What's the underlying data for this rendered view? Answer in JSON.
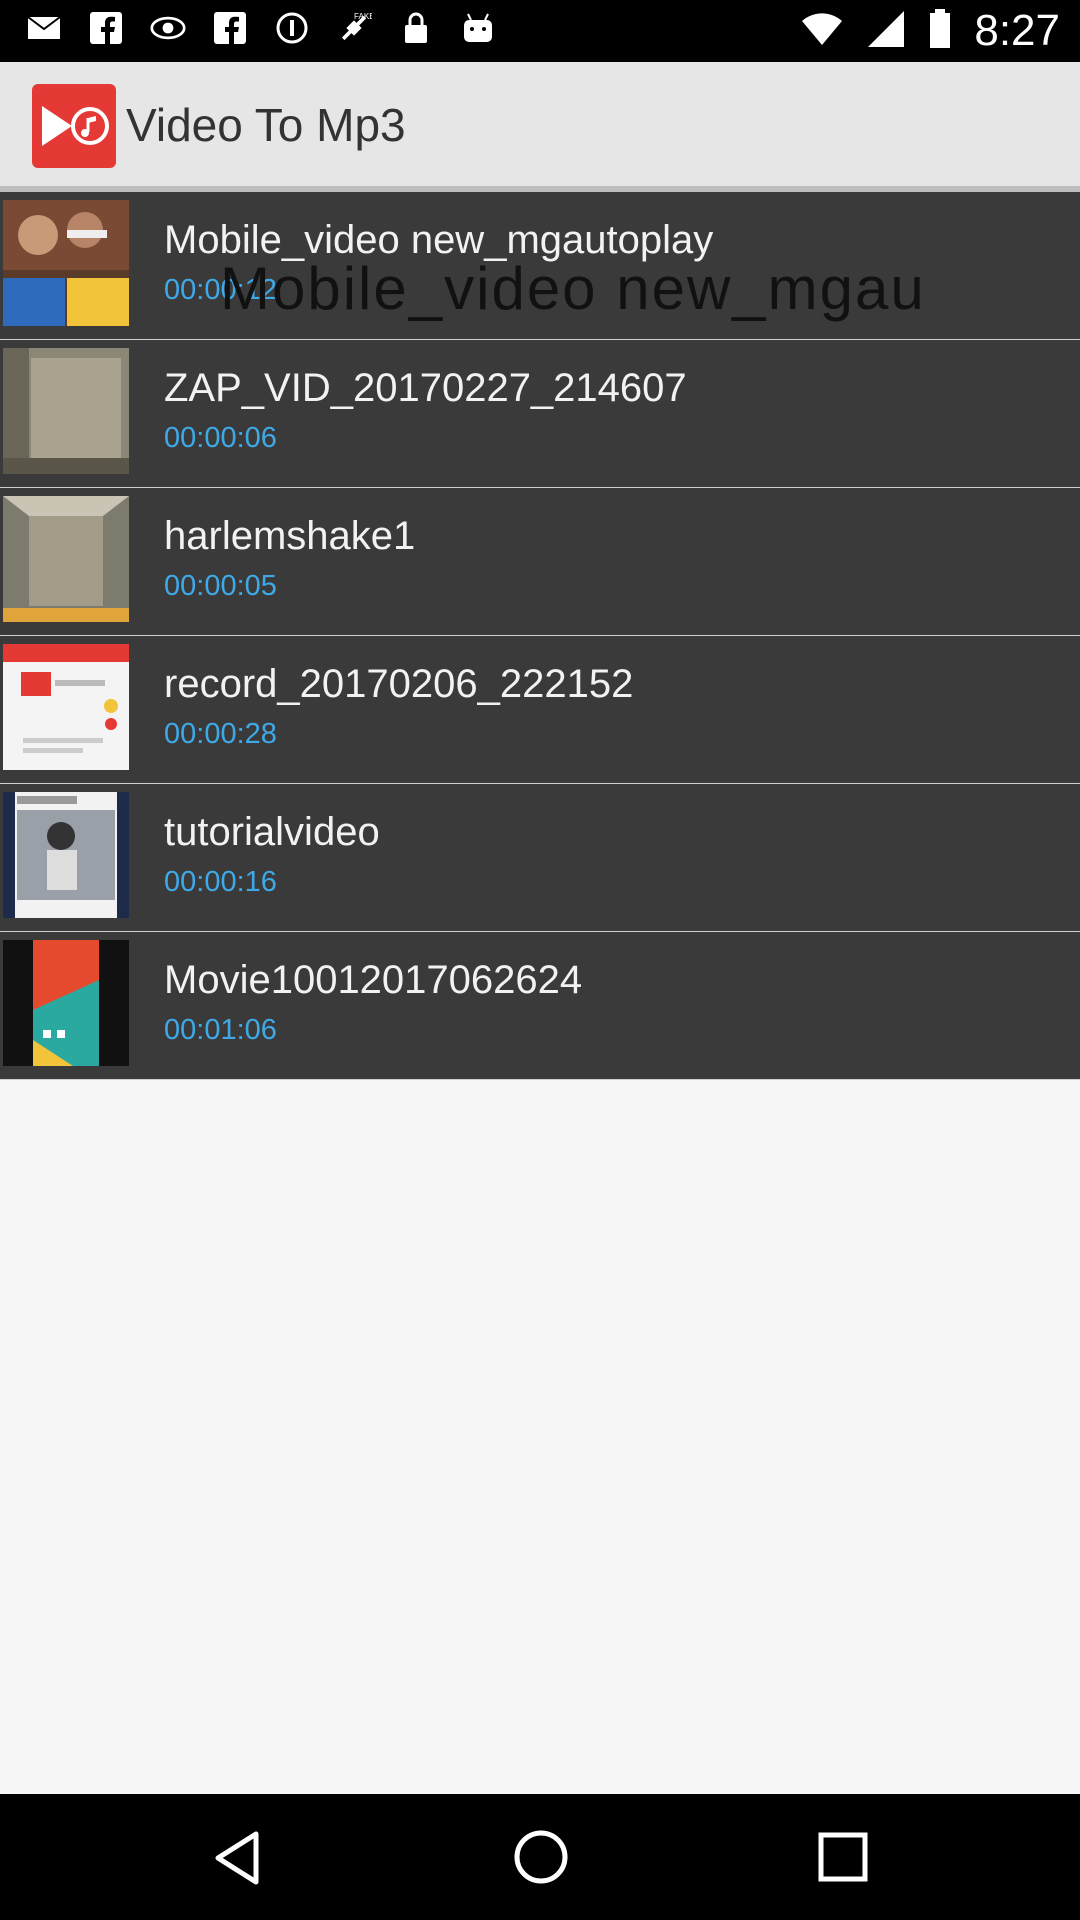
{
  "status_bar": {
    "time": "8:27",
    "left_icons": [
      "mail-icon",
      "facebook-icon",
      "eye-icon",
      "facebook-icon",
      "info-icon",
      "fake-gps-icon",
      "lock-icon",
      "android-icon"
    ]
  },
  "app_bar": {
    "title": "Video To Mp3",
    "logo_color": "#e53935"
  },
  "videos": [
    {
      "title": "Mobile_video new_mgautoplay",
      "duration": "00:00:12"
    },
    {
      "title": "ZAP_VID_20170227_214607",
      "duration": "00:00:06"
    },
    {
      "title": "harlemshake1",
      "duration": "00:00:05"
    },
    {
      "title": "record_20170206_222152",
      "duration": "00:00:28"
    },
    {
      "title": "tutorialvideo",
      "duration": "00:00:16"
    },
    {
      "title": "Movie10012017062624",
      "duration": "00:01:06"
    }
  ],
  "overlay": {
    "text": "Mobile_video new_mgau"
  },
  "colors": {
    "list_bg": "#3a3a3a",
    "duration_text": "#3fa9e8",
    "accent": "#e53935"
  }
}
